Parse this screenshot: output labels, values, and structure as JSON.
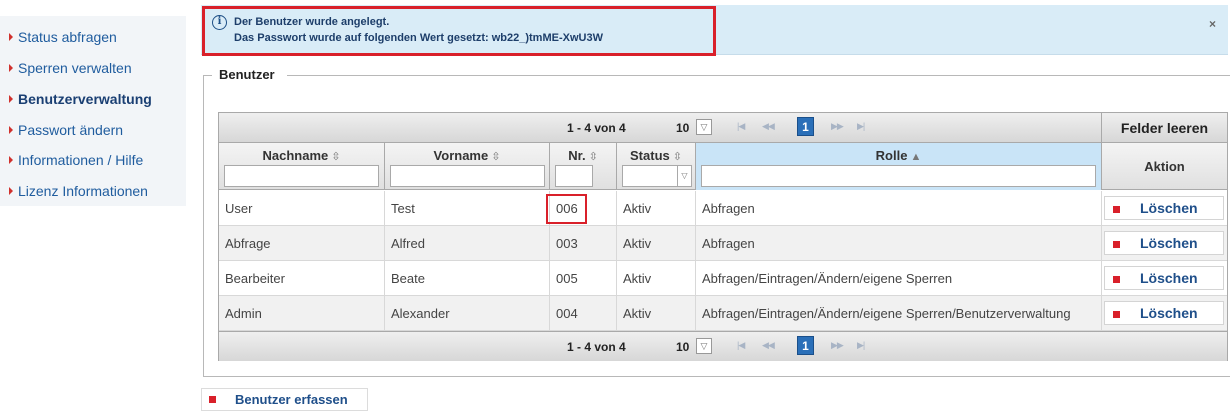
{
  "sidebar": {
    "items": [
      {
        "label": "Status abfragen"
      },
      {
        "label": "Sperren verwalten"
      },
      {
        "label": "Benutzerverwaltung"
      },
      {
        "label": "Passwort ändern"
      },
      {
        "label": "Informationen / Hilfe"
      },
      {
        "label": "Lizenz Informationen"
      }
    ],
    "active_index": 2
  },
  "notification": {
    "icon": "info-icon",
    "line1": "Der Benutzer wurde angelegt.",
    "line2": "Das Passwort wurde auf folgenden Wert gesetzt: wb22_)tmME-XwU3W",
    "close_label": "×"
  },
  "section": {
    "legend": "Benutzer"
  },
  "pager": {
    "info": "1 - 4 von 4",
    "page_size": "10",
    "current_page": "1",
    "first_label": "|◀",
    "prev_label": "◀◀",
    "next_label": "▶▶",
    "last_label": "▶|"
  },
  "clear_fields_label": "Felder leeren",
  "table": {
    "columns": [
      {
        "label": "Nachname",
        "sort": "⇳"
      },
      {
        "label": "Vorname",
        "sort": "⇳"
      },
      {
        "label": "Nr.",
        "sort": "⇳"
      },
      {
        "label": "Status",
        "sort": "⇳"
      },
      {
        "label": "Rolle",
        "sort": "▲"
      },
      {
        "label": "Aktion"
      }
    ],
    "rows": [
      {
        "nachname": "User",
        "vorname": "Test",
        "nr": "006",
        "status": "Aktiv",
        "rolle": "Abfragen",
        "aktion": "Löschen"
      },
      {
        "nachname": "Abfrage",
        "vorname": "Alfred",
        "nr": "003",
        "status": "Aktiv",
        "rolle": "Abfragen",
        "aktion": "Löschen"
      },
      {
        "nachname": "Bearbeiter",
        "vorname": "Beate",
        "nr": "005",
        "status": "Aktiv",
        "rolle": "Abfragen/Eintragen/Ändern/eigene Sperren",
        "aktion": "Löschen"
      },
      {
        "nachname": "Admin",
        "vorname": "Alexander",
        "nr": "004",
        "status": "Aktiv",
        "rolle": "Abfragen/Eintragen/Ändern/eigene Sperren/Benutzerverwaltung",
        "aktion": "Löschen"
      }
    ]
  },
  "create_button_label": "Benutzer erfassen",
  "colors": {
    "accent_red": "#d9202a",
    "link_blue": "#1f5c9e",
    "highlight_blue": "#c9e4f7"
  }
}
